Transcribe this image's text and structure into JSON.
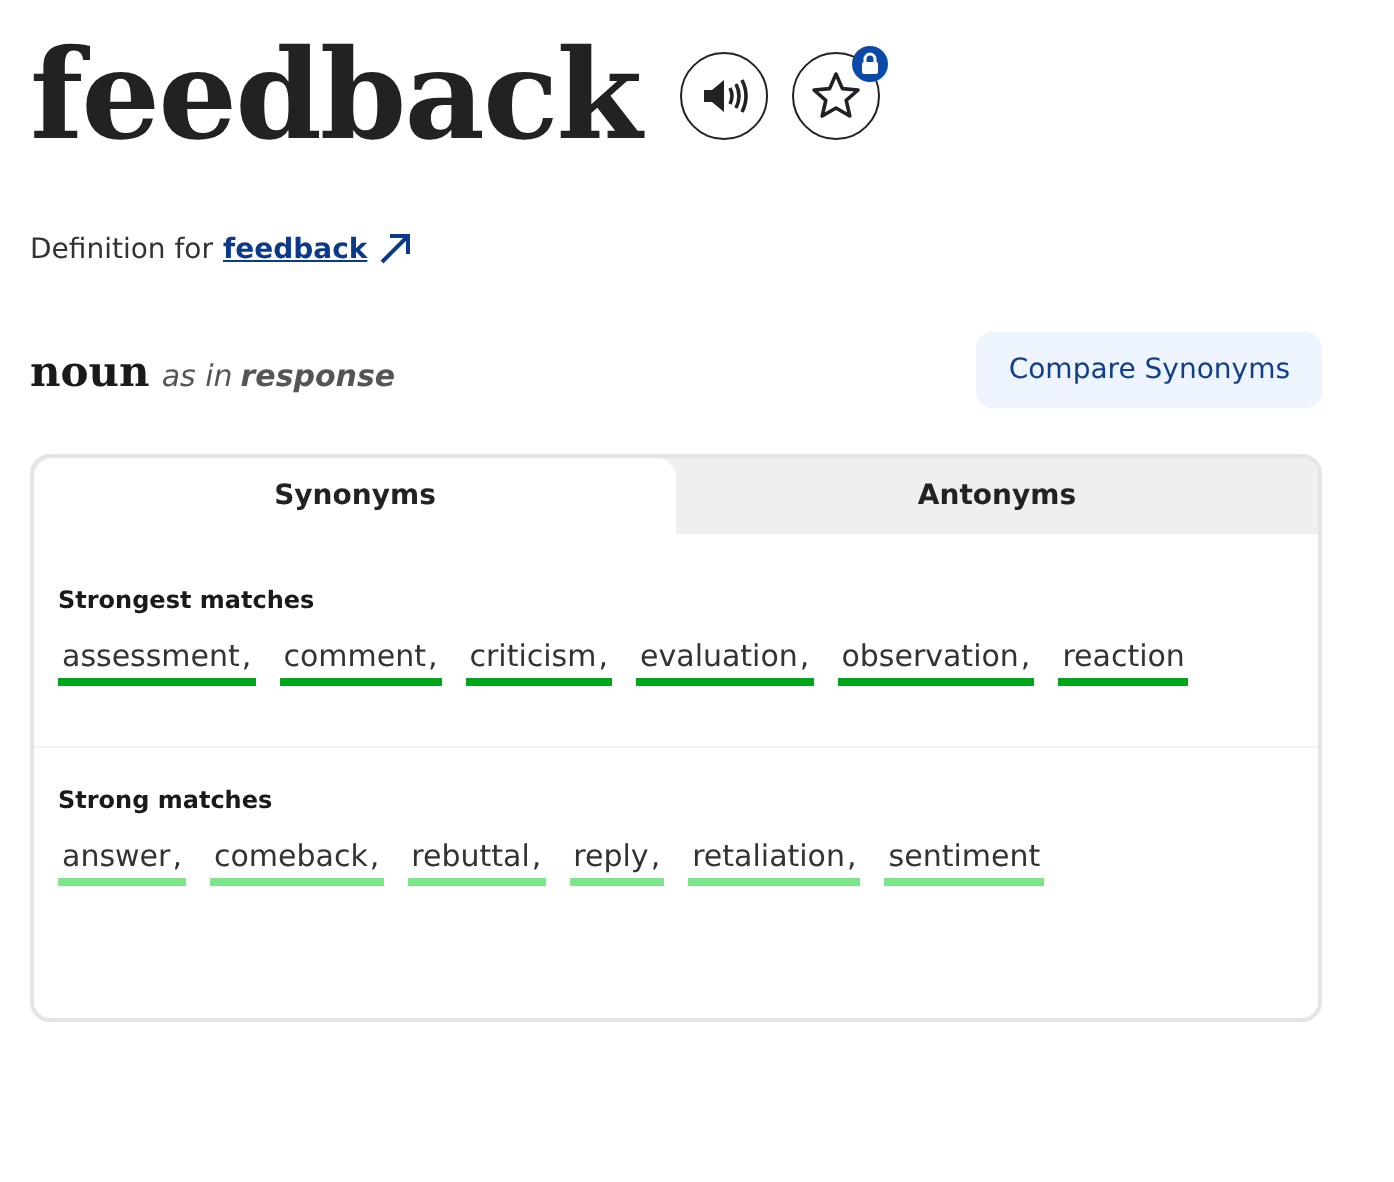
{
  "headword": "feedback",
  "definition_line": {
    "prefix": "Definition for",
    "link": "feedback"
  },
  "sense": {
    "part_of_speech": "noun",
    "as_in": "as in",
    "example": "response"
  },
  "compare_button": "Compare Synonyms",
  "tabs": [
    {
      "label": "Synonyms",
      "selected": true
    },
    {
      "label": "Antonyms",
      "selected": false
    }
  ],
  "groups": [
    {
      "title": "Strongest matches",
      "color": "#00a619",
      "words": [
        "assessment",
        "comment",
        "criticism",
        "evaluation",
        "observation",
        "reaction"
      ]
    },
    {
      "title": "Strong matches",
      "color": "#7ee68a",
      "words": [
        "answer",
        "comeback",
        "rebuttal",
        "reply",
        "retaliation",
        "sentiment"
      ]
    }
  ],
  "separator": ","
}
